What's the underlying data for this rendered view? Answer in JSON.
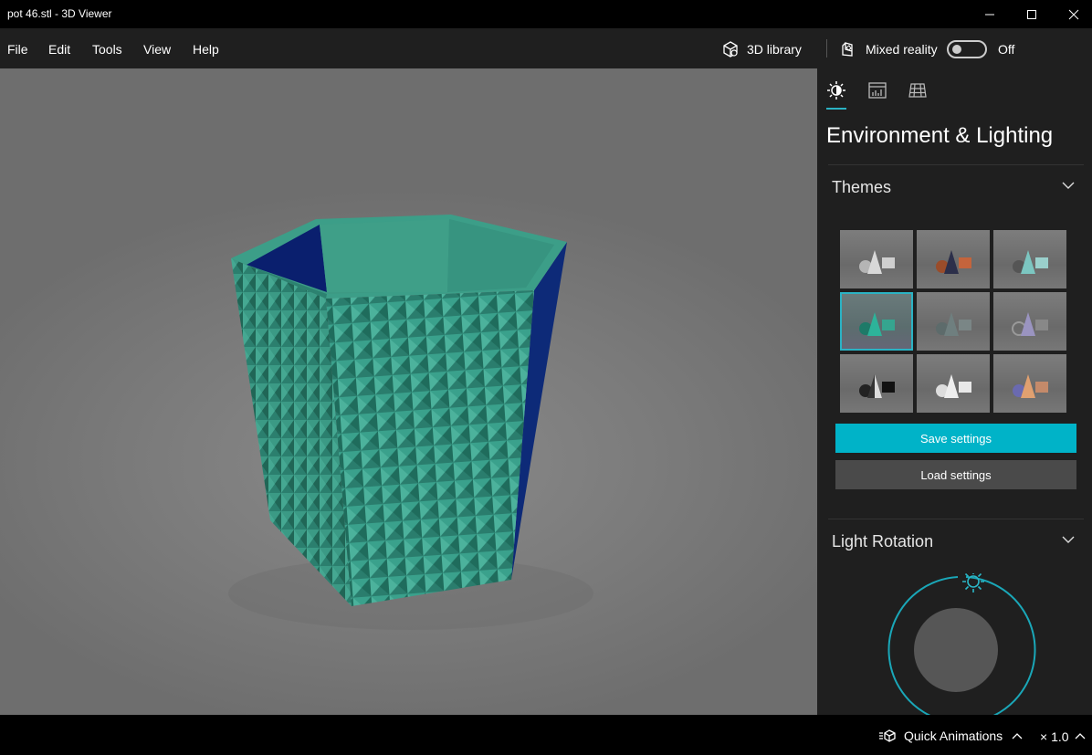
{
  "window": {
    "title": "pot 46.stl - 3D Viewer",
    "controls": [
      "minimize-icon",
      "maximize-icon",
      "close-icon"
    ]
  },
  "menu": {
    "items": [
      "File",
      "Edit",
      "Tools",
      "View",
      "Help"
    ],
    "library_label": "3D library",
    "mixed_reality_label": "Mixed reality",
    "mixed_reality_state": "Off"
  },
  "panel": {
    "tabs": [
      "sun-icon",
      "stats-icon",
      "grid-icon"
    ],
    "title": "Environment & Lighting",
    "themes_label": "Themes",
    "themes_selected_index": 3,
    "save_label": "Save settings",
    "load_label": "Load settings",
    "light_rotation_label": "Light Rotation"
  },
  "status": {
    "quick_animations_label": "Quick Animations",
    "zoom_label": "× 1.0"
  },
  "colors": {
    "accent": "#00b3c8",
    "model_teal": "#2e8f7c",
    "model_inner_blue": "#0a1f6e",
    "panel_bg": "#1f1f1f"
  }
}
